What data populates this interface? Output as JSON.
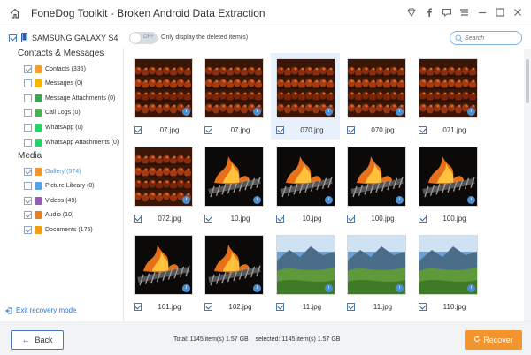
{
  "app": {
    "title": "FoneDog Toolkit - Broken Android Data Extraction"
  },
  "titlebar_icons": [
    "home-icon",
    "diamond-icon",
    "facebook-icon",
    "chat-icon",
    "menu-icon",
    "minimize-icon",
    "maximize-icon",
    "close-icon"
  ],
  "device": {
    "name": "SAMSUNG GALAXY S4",
    "checked": true
  },
  "sections": [
    {
      "heading": "Contacts & Messages",
      "items": [
        {
          "label": "Contacts (336)",
          "checked": true,
          "icon": "contacts-icon",
          "color": "#f0a030"
        },
        {
          "label": "Messages (0)",
          "checked": false,
          "icon": "messages-icon",
          "color": "#f5b400"
        },
        {
          "label": "Message Attachments (0)",
          "checked": false,
          "icon": "attachment-icon",
          "color": "#3aa655"
        },
        {
          "label": "Call Logs (0)",
          "checked": false,
          "icon": "phone-icon",
          "color": "#4caf50"
        },
        {
          "label": "WhatsApp (0)",
          "checked": false,
          "icon": "whatsapp-icon",
          "color": "#25d366"
        },
        {
          "label": "WhatsApp Attachments (0)",
          "checked": false,
          "icon": "whatsapp-attachment-icon",
          "color": "#25d366"
        }
      ]
    },
    {
      "heading": "Media",
      "items": [
        {
          "label": "Gallery (574)",
          "checked": true,
          "icon": "gallery-icon",
          "color": "#f2952f",
          "active": true
        },
        {
          "label": "Picture Library (0)",
          "checked": false,
          "icon": "picture-library-icon",
          "color": "#5aa0e6"
        },
        {
          "label": "Videos (49)",
          "checked": true,
          "icon": "videos-icon",
          "color": "#9b59b6"
        },
        {
          "label": "Audio (10)",
          "checked": true,
          "icon": "audio-icon",
          "color": "#e67e22"
        },
        {
          "label": "Documents (176)",
          "checked": true,
          "icon": "documents-icon",
          "color": "#f39c12"
        }
      ]
    }
  ],
  "exit_label": "Exit recovery mode",
  "toolbar": {
    "toggle_label": "OFF",
    "toggle_on": false,
    "only_deleted_label": "Only display the deleted item(s)",
    "search_placeholder": "Search"
  },
  "grid": [
    {
      "name": "07.jpg",
      "type": "meat-skewers",
      "checked": true,
      "selected": false
    },
    {
      "name": "07.jpg",
      "type": "meat-skewers",
      "checked": true,
      "selected": false
    },
    {
      "name": "070.jpg",
      "type": "meat-skewers",
      "checked": true,
      "selected": true
    },
    {
      "name": "070.jpg",
      "type": "meat-skewers",
      "checked": true,
      "selected": false
    },
    {
      "name": "071.jpg",
      "type": "meat-skewers",
      "checked": true,
      "selected": false
    },
    {
      "name": "072.jpg",
      "type": "meat-skewers",
      "checked": true,
      "selected": false
    },
    {
      "name": "10.jpg",
      "type": "grill-fire",
      "checked": true,
      "selected": false
    },
    {
      "name": "10.jpg",
      "type": "grill-fire",
      "checked": true,
      "selected": false
    },
    {
      "name": "100.jpg",
      "type": "grill-fire",
      "checked": true,
      "selected": false
    },
    {
      "name": "100.jpg",
      "type": "grill-fire",
      "checked": true,
      "selected": false
    },
    {
      "name": "101.jpg",
      "type": "grill-fire",
      "checked": true,
      "selected": false
    },
    {
      "name": "102.jpg",
      "type": "grill-fire",
      "checked": true,
      "selected": false
    },
    {
      "name": "11.jpg",
      "type": "landscape",
      "checked": true,
      "selected": false
    },
    {
      "name": "11.jpg",
      "type": "landscape",
      "checked": true,
      "selected": false
    },
    {
      "name": "110.jpg",
      "type": "landscape",
      "checked": true,
      "selected": false
    }
  ],
  "status": {
    "total": "Total: 1145 item(s) 1.57 GB",
    "selected": "selected: 1145 item(s) 1.57 GB"
  },
  "buttons": {
    "back": "Back",
    "recover": "Recover"
  },
  "colors": {
    "accent": "#2e74c9",
    "recover": "#f2952f",
    "info": "#4d8fd1",
    "selection": "#e7f0fb"
  }
}
